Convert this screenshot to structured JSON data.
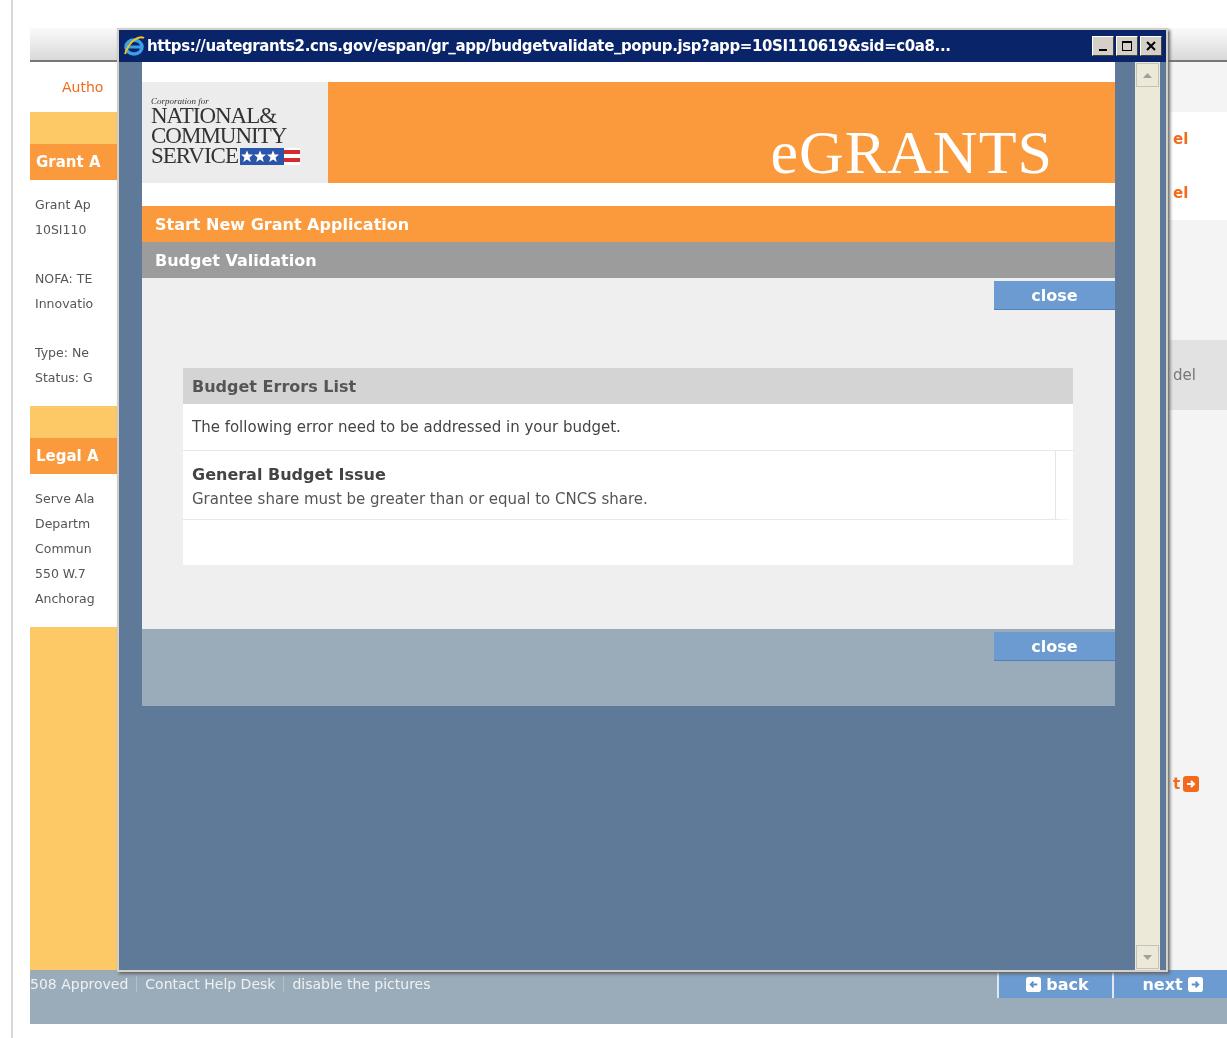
{
  "background_page": {
    "sidebar": {
      "link": "Autho",
      "sections": [
        {
          "title": "Grant A",
          "paragraphs": [
            [
              "Grant Ap",
              "10SI110"
            ],
            [
              "NOFA: TE",
              "Innovatio"
            ],
            [
              "Type: Ne",
              "Status: G"
            ]
          ]
        },
        {
          "title": "Legal A",
          "paragraphs": [
            [
              "Serve Ala",
              "Departm",
              "Commun",
              "550 W.7",
              "Anchorag"
            ]
          ]
        }
      ]
    },
    "right_strip": [
      {
        "kind": "link",
        "text": "el"
      },
      {
        "kind": "link",
        "text": "el"
      },
      {
        "kind": "label",
        "text": "del"
      },
      {
        "kind": "next",
        "text": "t"
      }
    ],
    "footer": {
      "links": [
        "508 Approved",
        "Contact Help Desk",
        "disable the pictures"
      ],
      "buttons": [
        {
          "kind": "back",
          "label": "back"
        },
        {
          "kind": "next",
          "label": "next"
        }
      ]
    }
  },
  "popup": {
    "title": "https://uategrants2.cns.gov/espan/gr_app/budgetvalidate_popup.jsp?app=10SI110619&sid=c0a8...",
    "logo": {
      "caption": "Corporation for",
      "lines": [
        "NATIONAL&",
        "COMMUNITY",
        "SERVICE"
      ]
    },
    "brand": "eGRANTS",
    "nav_bar": "Start New Grant Application",
    "section_bar": "Budget Validation",
    "close_buttons": [
      "close",
      "close"
    ],
    "errors_panel": {
      "title": "Budget Errors List",
      "intro": "The following error need to be addressed in your budget.",
      "issues": [
        {
          "title": "General Budget Issue",
          "text": "Grantee share must be greater than or equal to CNCS share."
        }
      ]
    }
  }
}
